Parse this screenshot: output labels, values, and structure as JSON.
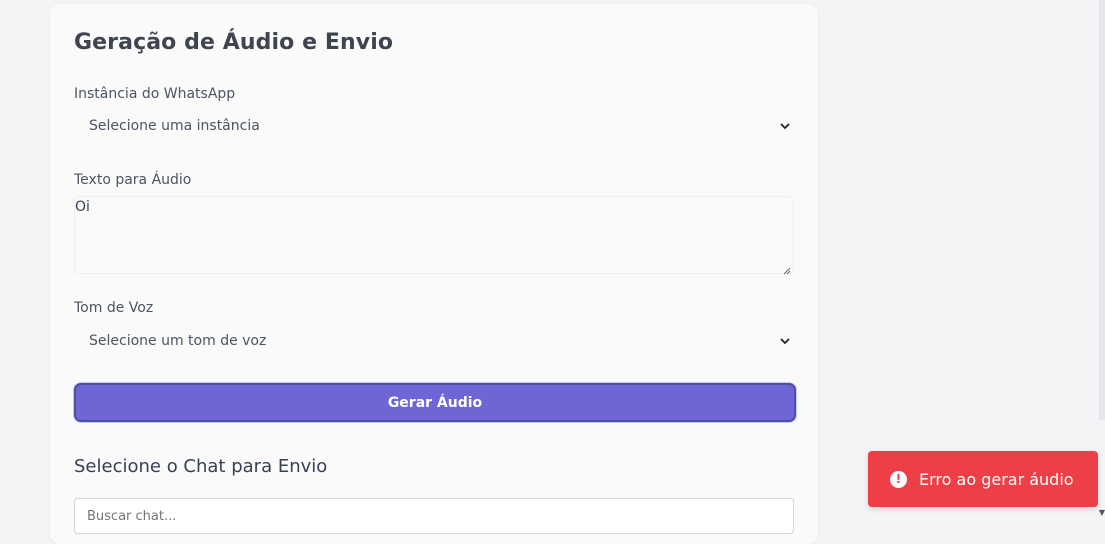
{
  "card": {
    "title": "Geração de Áudio e Envio"
  },
  "instance": {
    "label": "Instância do WhatsApp",
    "selected": "Selecione uma instância"
  },
  "text": {
    "label": "Texto para Áudio",
    "value": "Oi"
  },
  "voice": {
    "label": "Tom de Voz",
    "selected": "Selecione um tom de voz"
  },
  "generate_button": "Gerar Áudio",
  "chat": {
    "title": "Selecione o Chat para Envio",
    "search_placeholder": "Buscar chat..."
  },
  "toast": {
    "message": "Erro ao gerar áudio",
    "icon": "alert-circle-icon",
    "color": "#ee3f46"
  },
  "colors": {
    "accent": "#6e66d4"
  }
}
